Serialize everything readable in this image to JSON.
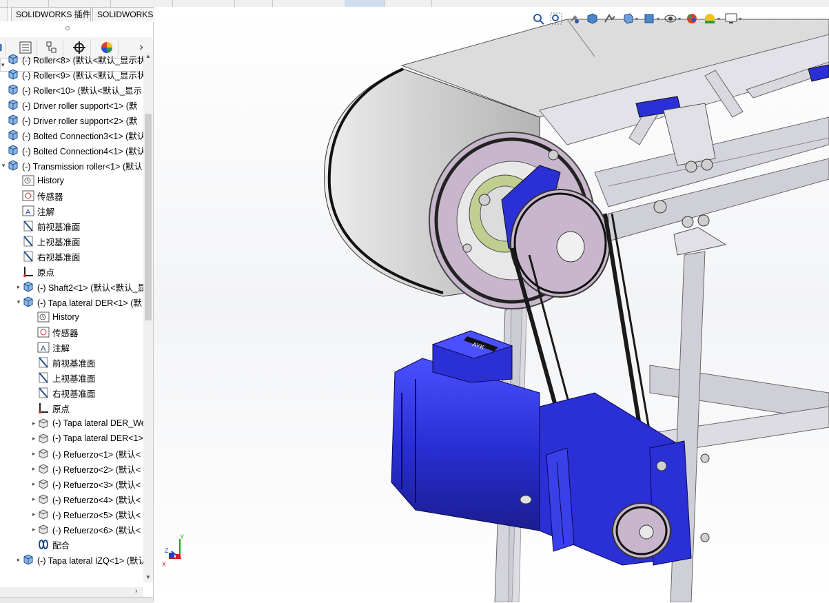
{
  "top_tabs": [
    {
      "label": "SOLIDWORKS 插件"
    },
    {
      "label": "SOLIDWORKS MBD"
    }
  ],
  "panel_icons": [
    "feature-manager-icon",
    "property-manager-icon",
    "configuration-manager-icon",
    "dimxpert-icon",
    "display-manager-icon"
  ],
  "tree": [
    {
      "label": "(-) Roller<8> (默认<默认_显示状",
      "expander": "",
      "icon": "part"
    },
    {
      "label": "(-) Roller<9> (默认<默认_显示状",
      "expander": "",
      "icon": "part"
    },
    {
      "label": "(-) Roller<10> (默认<默认_显示",
      "expander": "",
      "icon": "part"
    },
    {
      "label": "(-) Driver roller support<1> (默",
      "expander": "",
      "icon": "part"
    },
    {
      "label": "(-) Driver roller support<2> (默",
      "expander": "",
      "icon": "part"
    },
    {
      "label": "(-) Bolted Connection3<1> (默认",
      "expander": "",
      "icon": "part"
    },
    {
      "label": "(-) Bolted Connection4<1> (默认",
      "expander": "",
      "icon": "part"
    },
    {
      "label": "(-) Transmission roller<1> (默认",
      "expander": "▾",
      "icon": "part"
    },
    {
      "label": "History",
      "expander": "",
      "icon": "history"
    },
    {
      "label": "传感器",
      "expander": "",
      "icon": "sensor"
    },
    {
      "label": "注解",
      "expander": "",
      "icon": "annotation"
    },
    {
      "label": "前视基准面",
      "expander": "",
      "icon": "plane"
    },
    {
      "label": "上视基准面",
      "expander": "",
      "icon": "plane"
    },
    {
      "label": "右视基准面",
      "expander": "",
      "icon": "plane"
    },
    {
      "label": "原点",
      "expander": "",
      "icon": "origin"
    },
    {
      "label": "(-) Shaft2<1> (默认<默认_显",
      "expander": "▸",
      "icon": "part"
    },
    {
      "label": "(-) Tapa lateral DER<1> (默",
      "expander": "▾",
      "icon": "part"
    },
    {
      "label": "History",
      "expander": "",
      "icon": "history"
    },
    {
      "label": "传感器",
      "expander": "",
      "icon": "sensor"
    },
    {
      "label": "注解",
      "expander": "",
      "icon": "annotation"
    },
    {
      "label": "前视基准面",
      "expander": "",
      "icon": "plane"
    },
    {
      "label": "上视基准面",
      "expander": "",
      "icon": "plane"
    },
    {
      "label": "右视基准面",
      "expander": "",
      "icon": "plane"
    },
    {
      "label": "原点",
      "expander": "",
      "icon": "origin"
    },
    {
      "label": "(-) Tapa lateral DER_We",
      "expander": "▸",
      "icon": "feature"
    },
    {
      "label": "(-) Tapa lateral DER<1>",
      "expander": "▸",
      "icon": "feature"
    },
    {
      "label": "(-) Refuerzo<1> (默认<",
      "expander": "▸",
      "icon": "feature"
    },
    {
      "label": "(-) Refuerzo<2> (默认<",
      "expander": "▸",
      "icon": "feature"
    },
    {
      "label": "(-) Refuerzo<3> (默认<",
      "expander": "▸",
      "icon": "feature"
    },
    {
      "label": "(-) Refuerzo<4> (默认<",
      "expander": "▸",
      "icon": "feature"
    },
    {
      "label": "(-) Refuerzo<5> (默认<",
      "expander": "▸",
      "icon": "feature"
    },
    {
      "label": "(-) Refuerzo<6> (默认<",
      "expander": "▸",
      "icon": "feature"
    },
    {
      "label": "配合",
      "expander": "",
      "icon": "mates"
    },
    {
      "label": "(-) Tapa lateral IZQ<1> (默认",
      "expander": "▸",
      "icon": "part"
    }
  ],
  "view_toolbar_icons": [
    "zoom-to-fit-icon",
    "zoom-to-area-icon",
    "previous-view-icon",
    "section-view-icon",
    "dynamic-annotation-icon",
    "view-orientation-icon",
    "display-style-icon",
    "hide-show-items-icon",
    "edit-appearance-icon",
    "apply-scene-icon",
    "view-settings-icon"
  ],
  "motor_label": "AYK",
  "triad": {
    "x": "X",
    "y": "Y",
    "z": "Z"
  },
  "colors": {
    "motor": "#2a2fd6",
    "frame": "#cfcfd8",
    "belt": "#1a1a1a",
    "plate": "#c8b7cc"
  }
}
